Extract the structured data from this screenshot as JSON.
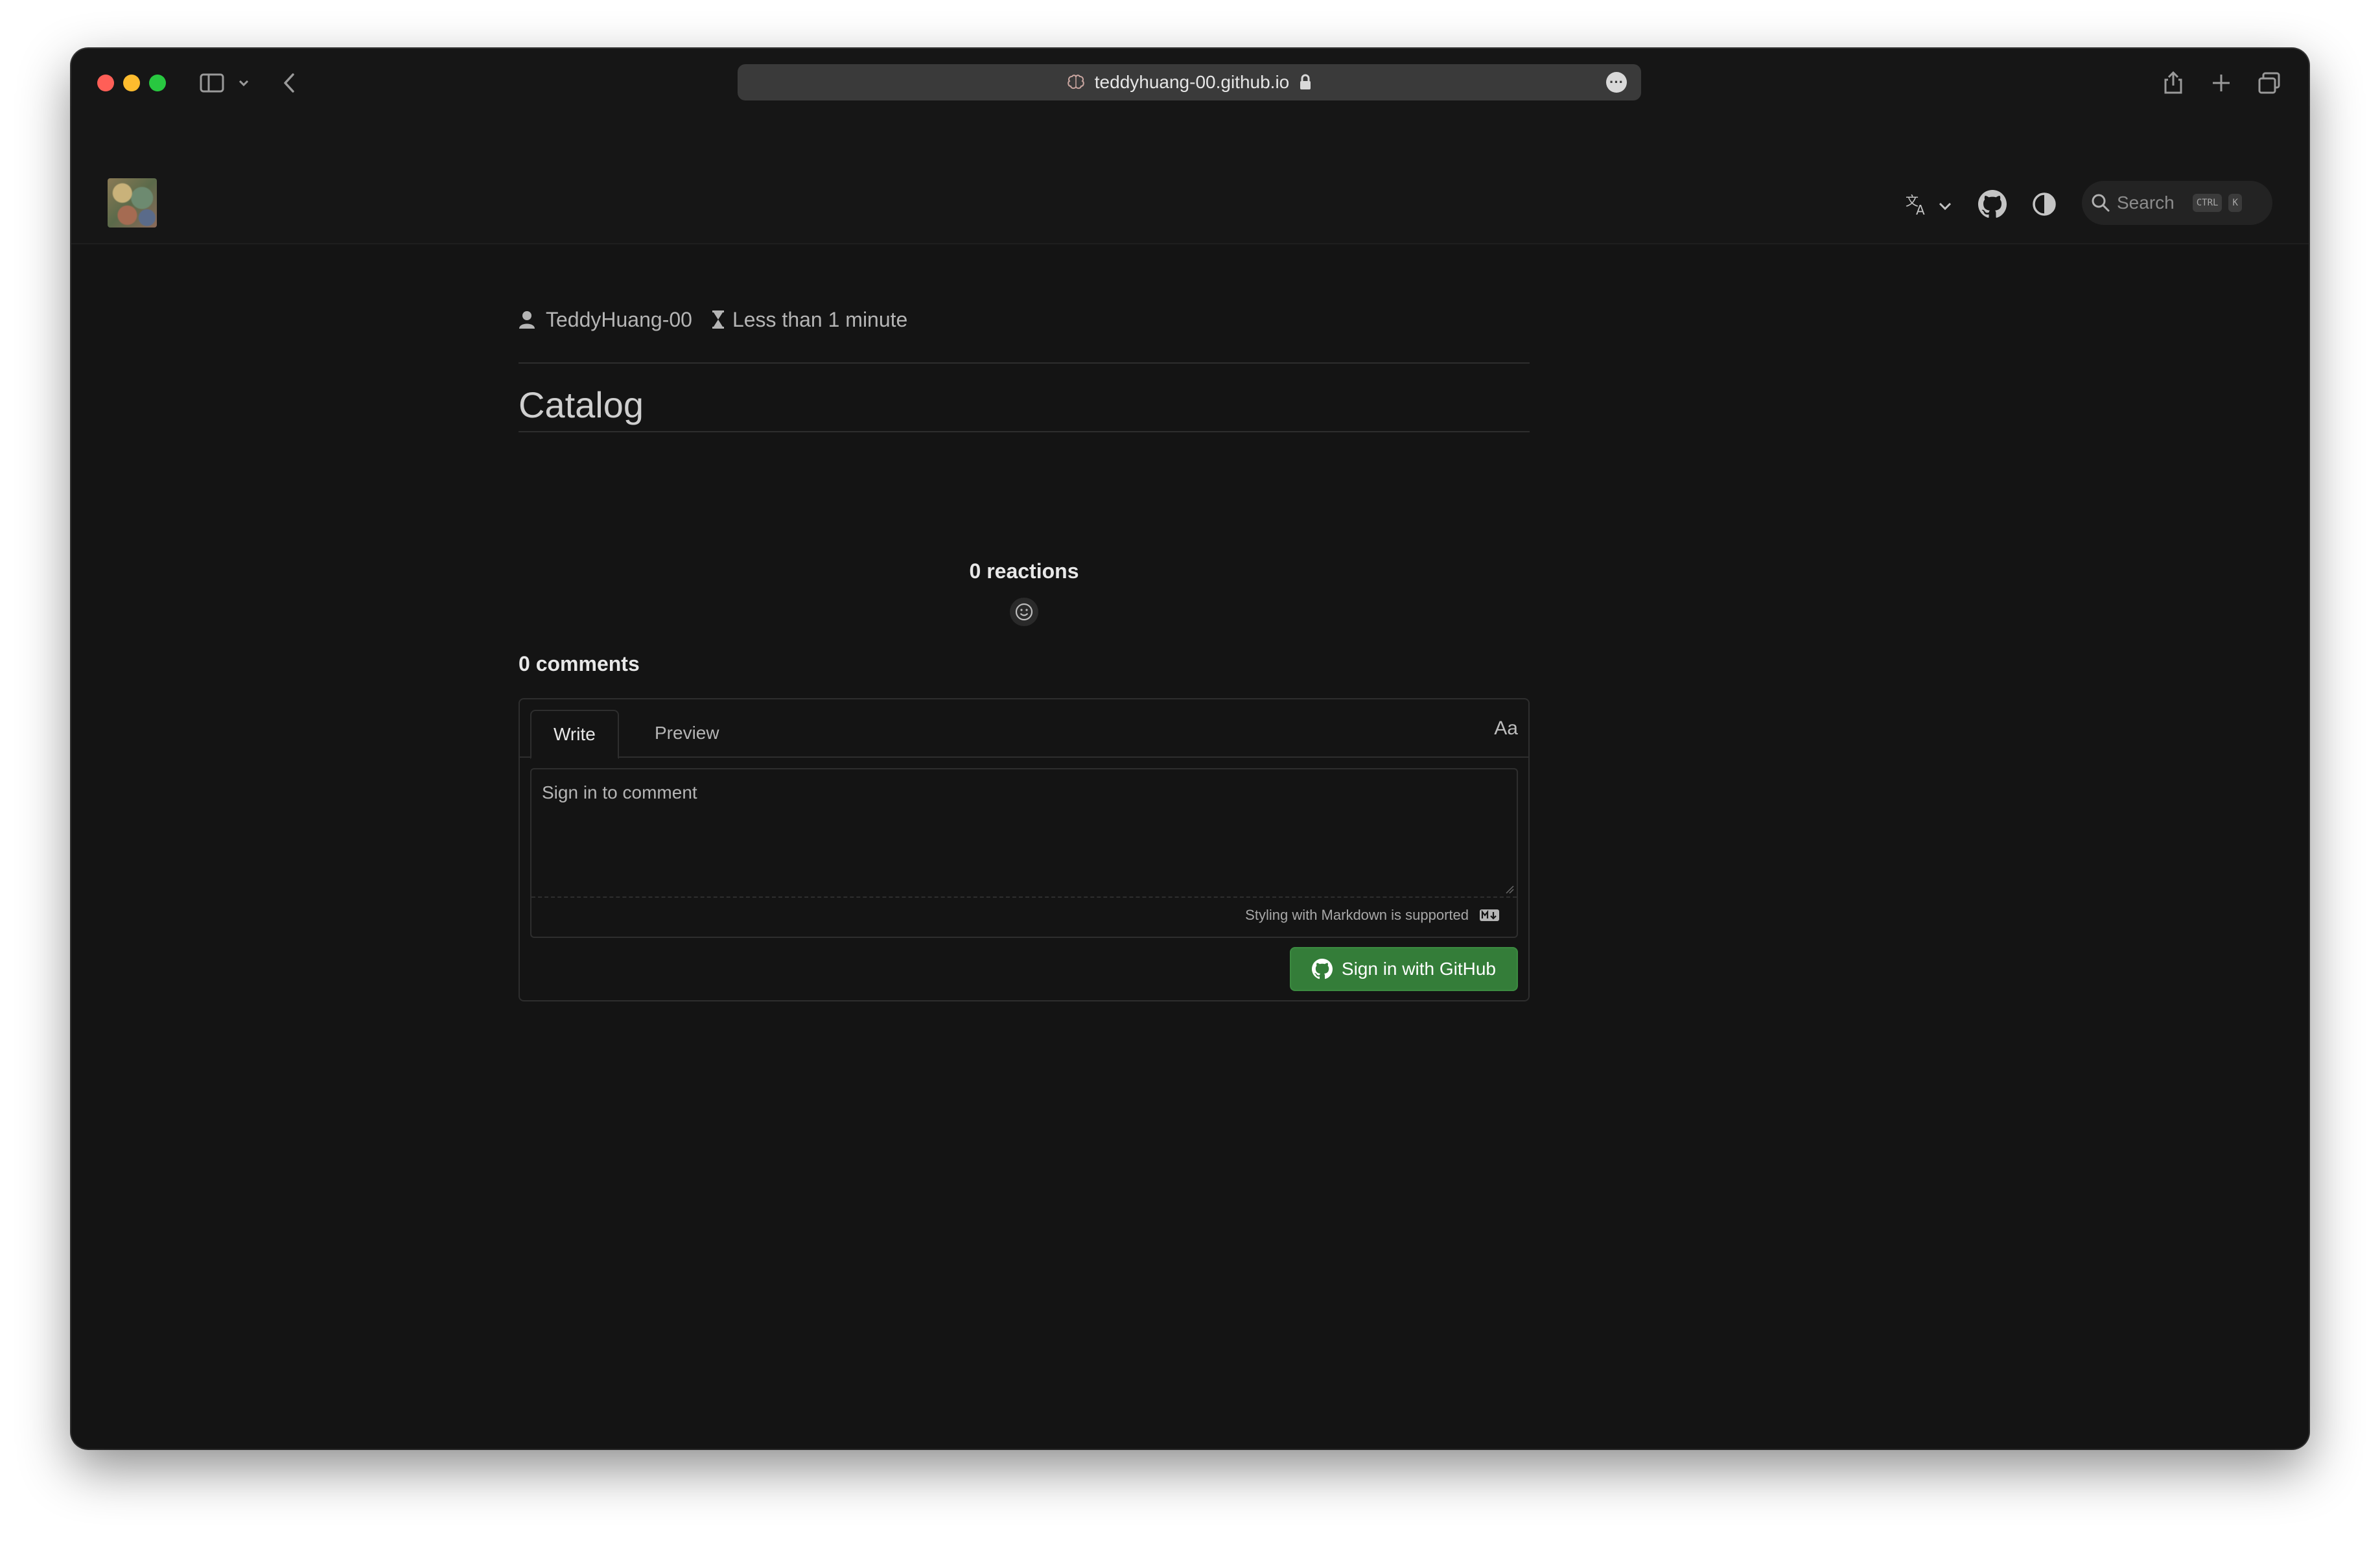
{
  "browser": {
    "url": "teddyhuang-00.github.io",
    "site_icon": "brain-icon",
    "lock_icon": "lock-icon",
    "more_label": "···"
  },
  "nav": {
    "logo": "site-logo",
    "search_placeholder": "Search",
    "search_key_1": "CTRL",
    "search_key_2": "K"
  },
  "article": {
    "author": "TeddyHuang-00",
    "reading_time": "Less than 1 minute",
    "title": "Catalog"
  },
  "reactions": {
    "label": "0 reactions"
  },
  "comments": {
    "count_label": "0 comments",
    "tabs": [
      {
        "label": "Write",
        "active": true
      },
      {
        "label": "Preview",
        "active": false
      }
    ],
    "format_toggle": "Aa",
    "placeholder": "Sign in to comment",
    "markdown_note": "Styling with Markdown is supported",
    "signin_label": "Sign in with GitHub"
  },
  "colors": {
    "background": "#141414",
    "button_green": "#347d39",
    "traffic_red": "#ff5f57",
    "traffic_yellow": "#febc2e",
    "traffic_green": "#28c840"
  }
}
